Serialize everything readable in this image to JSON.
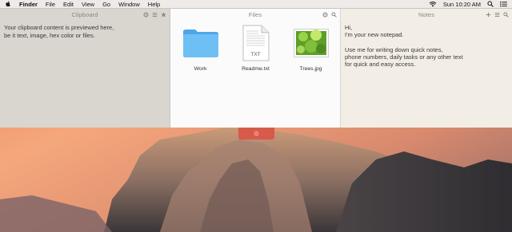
{
  "menubar": {
    "app_name": "Finder",
    "menus": [
      "File",
      "Edit",
      "View",
      "Go",
      "Window",
      "Help"
    ],
    "clock": "Sun 10:20 AM"
  },
  "clipboard": {
    "title": "Clipboard",
    "text_line1": "Your clipboard content is previewed here,",
    "text_line2": "be it text, image, hex color or files."
  },
  "files": {
    "title": "Files",
    "items": [
      {
        "name": "Work",
        "icon": "folder-icon"
      },
      {
        "name": "Readme.txt",
        "icon": "text-file-icon",
        "badge": "TXT"
      },
      {
        "name": "Trees.jpg",
        "icon": "image-thumbnail"
      }
    ]
  },
  "notes": {
    "title": "Notes",
    "line1": "Hi,",
    "line2": "I'm your new notepad.",
    "line3": "Use me for writing down quick notes,",
    "line4": "phone numbers, daily tasks or any other text",
    "line5": "for quick and easy access."
  },
  "colors": {
    "accent": "#d75a4a",
    "folder": "#5fb3ef",
    "clipboard_bg": "#d9d5cf",
    "notes_bg": "#f3eee5"
  }
}
